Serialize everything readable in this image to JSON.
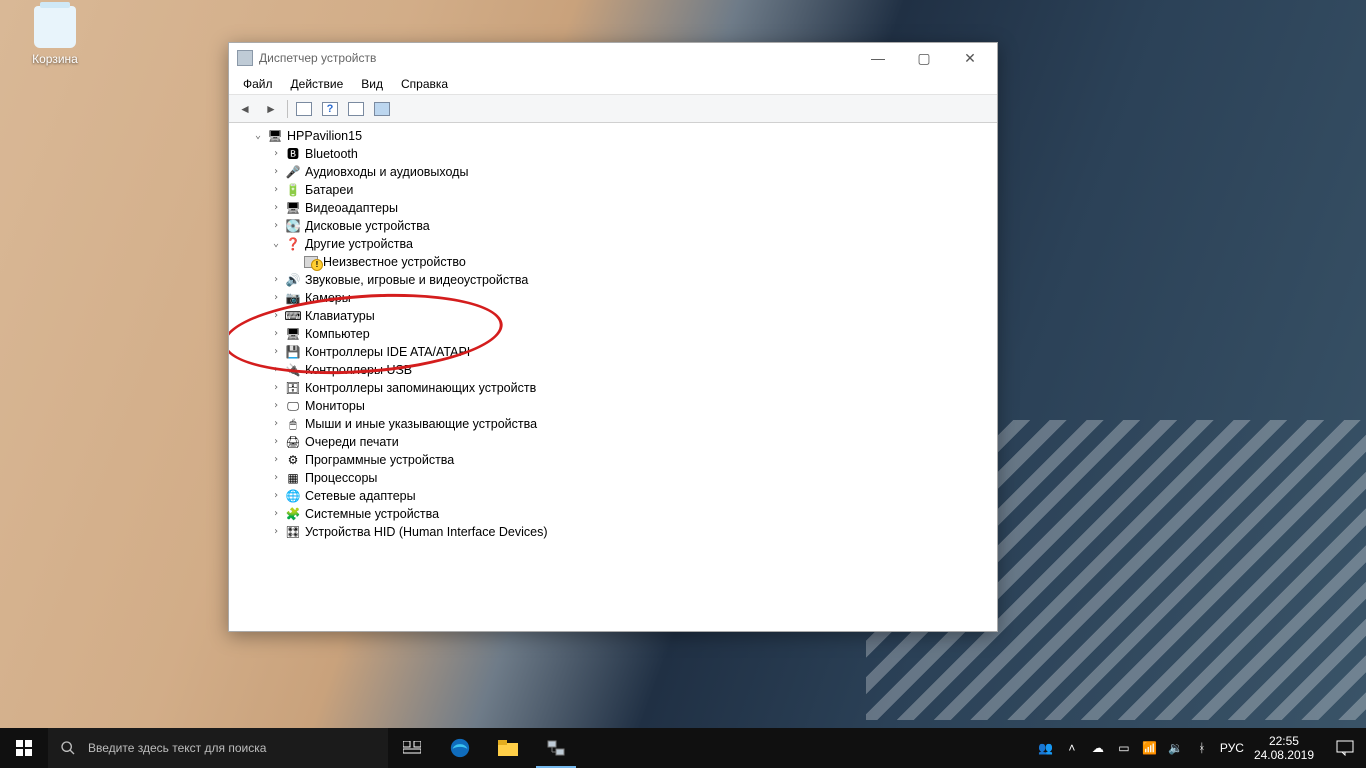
{
  "desktop": {
    "recycle_bin": "Корзина"
  },
  "window": {
    "title": "Диспетчер устройств",
    "menu": [
      "Файл",
      "Действие",
      "Вид",
      "Справка"
    ],
    "root": "HPPavilion15",
    "items": [
      {
        "icon": "bt",
        "label": "Bluetooth"
      },
      {
        "icon": "aud",
        "label": "Аудиовходы и аудиовыходы"
      },
      {
        "icon": "bat",
        "label": "Батареи"
      },
      {
        "icon": "vid",
        "label": "Видеоадаптеры"
      },
      {
        "icon": "disk",
        "label": "Дисковые устройства"
      },
      {
        "icon": "other",
        "label": "Другие устройства",
        "expanded": true,
        "children": [
          {
            "icon": "warn",
            "label": "Неизвестное устройство"
          }
        ]
      },
      {
        "icon": "snd",
        "label": "Звуковые, игровые и видеоустройства"
      },
      {
        "icon": "cam",
        "label": "Камеры"
      },
      {
        "icon": "kbd",
        "label": "Клавиатуры"
      },
      {
        "icon": "pc",
        "label": "Компьютер"
      },
      {
        "icon": "ide",
        "label": "Контроллеры IDE ATA/ATAPI"
      },
      {
        "icon": "usb",
        "label": "Контроллеры USB"
      },
      {
        "icon": "stor",
        "label": "Контроллеры запоминающих устройств"
      },
      {
        "icon": "mon",
        "label": "Мониторы"
      },
      {
        "icon": "mouse",
        "label": "Мыши и иные указывающие устройства"
      },
      {
        "icon": "prn",
        "label": "Очереди печати"
      },
      {
        "icon": "sw",
        "label": "Программные устройства"
      },
      {
        "icon": "cpu",
        "label": "Процессоры"
      },
      {
        "icon": "net",
        "label": "Сетевые адаптеры"
      },
      {
        "icon": "sys",
        "label": "Системные устройства"
      },
      {
        "icon": "hid",
        "label": "Устройства HID (Human Interface Devices)"
      }
    ]
  },
  "taskbar": {
    "search_placeholder": "Введите здесь текст для поиска",
    "lang": "РУС",
    "time": "22:55",
    "date": "24.08.2019"
  },
  "icons": {
    "bt": "🅱",
    "aud": "🎤",
    "bat": "🔋",
    "vid": "🖥",
    "disk": "💽",
    "other": "❓",
    "warn": "⚠",
    "snd": "🔊",
    "cam": "📷",
    "kbd": "⌨",
    "pc": "🖥",
    "ide": "💾",
    "usb": "🔌",
    "stor": "🗄",
    "mon": "🖵",
    "mouse": "🖱",
    "prn": "🖨",
    "sw": "⚙",
    "cpu": "▦",
    "net": "🌐",
    "sys": "🧩",
    "hid": "🎛",
    "root": "🖥"
  }
}
